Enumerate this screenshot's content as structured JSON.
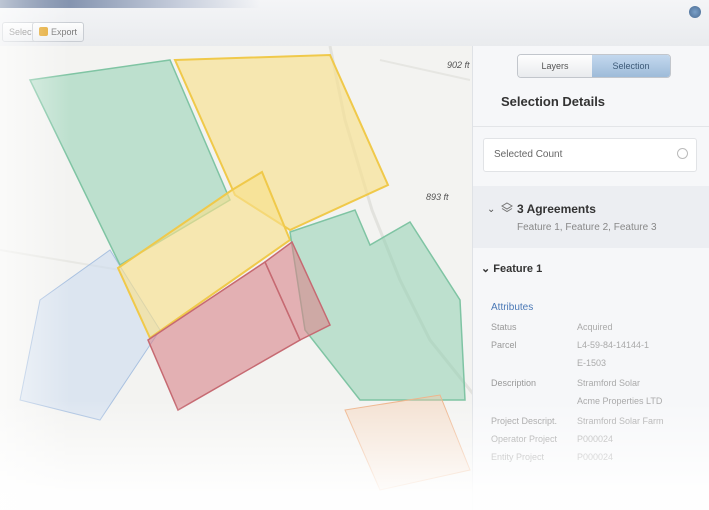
{
  "toolbar": {
    "button1": "Select",
    "button2": "Export"
  },
  "map": {
    "elevations": [
      "902 ft",
      "893 ft"
    ]
  },
  "panel": {
    "tabs": [
      "Layers",
      "Selection"
    ],
    "title": "Selection Details",
    "selected_count_label": "Selected Count",
    "agreements": {
      "title": "3 Agreements",
      "subtitle": "Feature 1, Feature 2, Feature 3"
    },
    "feature_header": "Feature 1",
    "attributes_header": "Attributes",
    "attributes": [
      {
        "label": "Status",
        "value": "Acquired"
      },
      {
        "label": "Parcel",
        "value": "L4-59-84-14144-1"
      },
      {
        "label": "",
        "value": "E-1503"
      },
      {
        "label": "Description",
        "value": "Stramford Solar"
      },
      {
        "label": "",
        "value": "Acme Properties LTD"
      },
      {
        "label": "Project Descript.",
        "value": "Stramford Solar Farm"
      },
      {
        "label": "Operator Project",
        "value": "P000024"
      },
      {
        "label": "Entity Project",
        "value": "P000024"
      }
    ]
  },
  "colors": {
    "green": "#8fcfb1",
    "yellow": "#f7e08e",
    "red": "#d9848b",
    "blue": "#c6d8ef",
    "accent": "#4a78b6"
  }
}
